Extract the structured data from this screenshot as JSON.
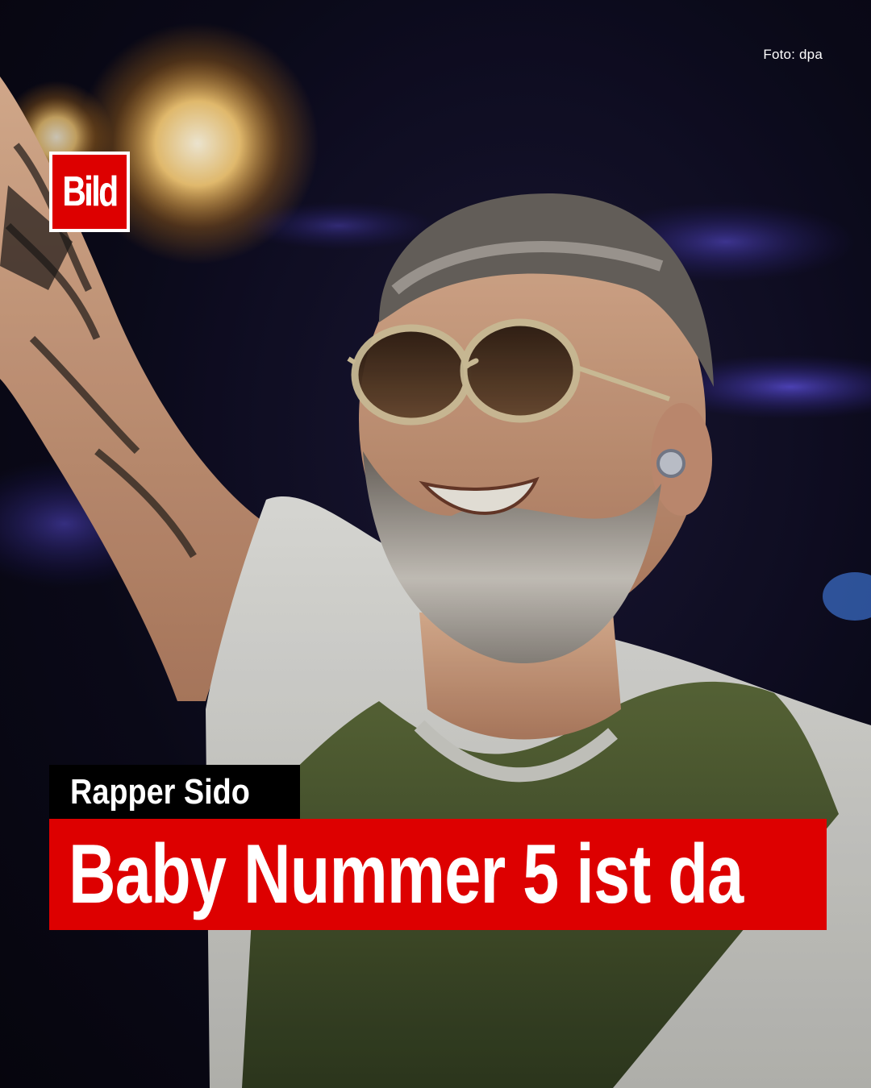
{
  "post": {
    "photo_credit": "Foto: dpa",
    "brand_logo": "Bild",
    "kicker": "Rapper Sido",
    "headline": "Baby Nummer 5 ist da"
  },
  "colors": {
    "brand_red": "#dd0000",
    "kicker_bg": "#000000",
    "text": "#ffffff"
  },
  "photo": {
    "subject": "smiling bearded man with round sunglasses raising tattooed arm on stage",
    "icon": "concert-photo"
  }
}
